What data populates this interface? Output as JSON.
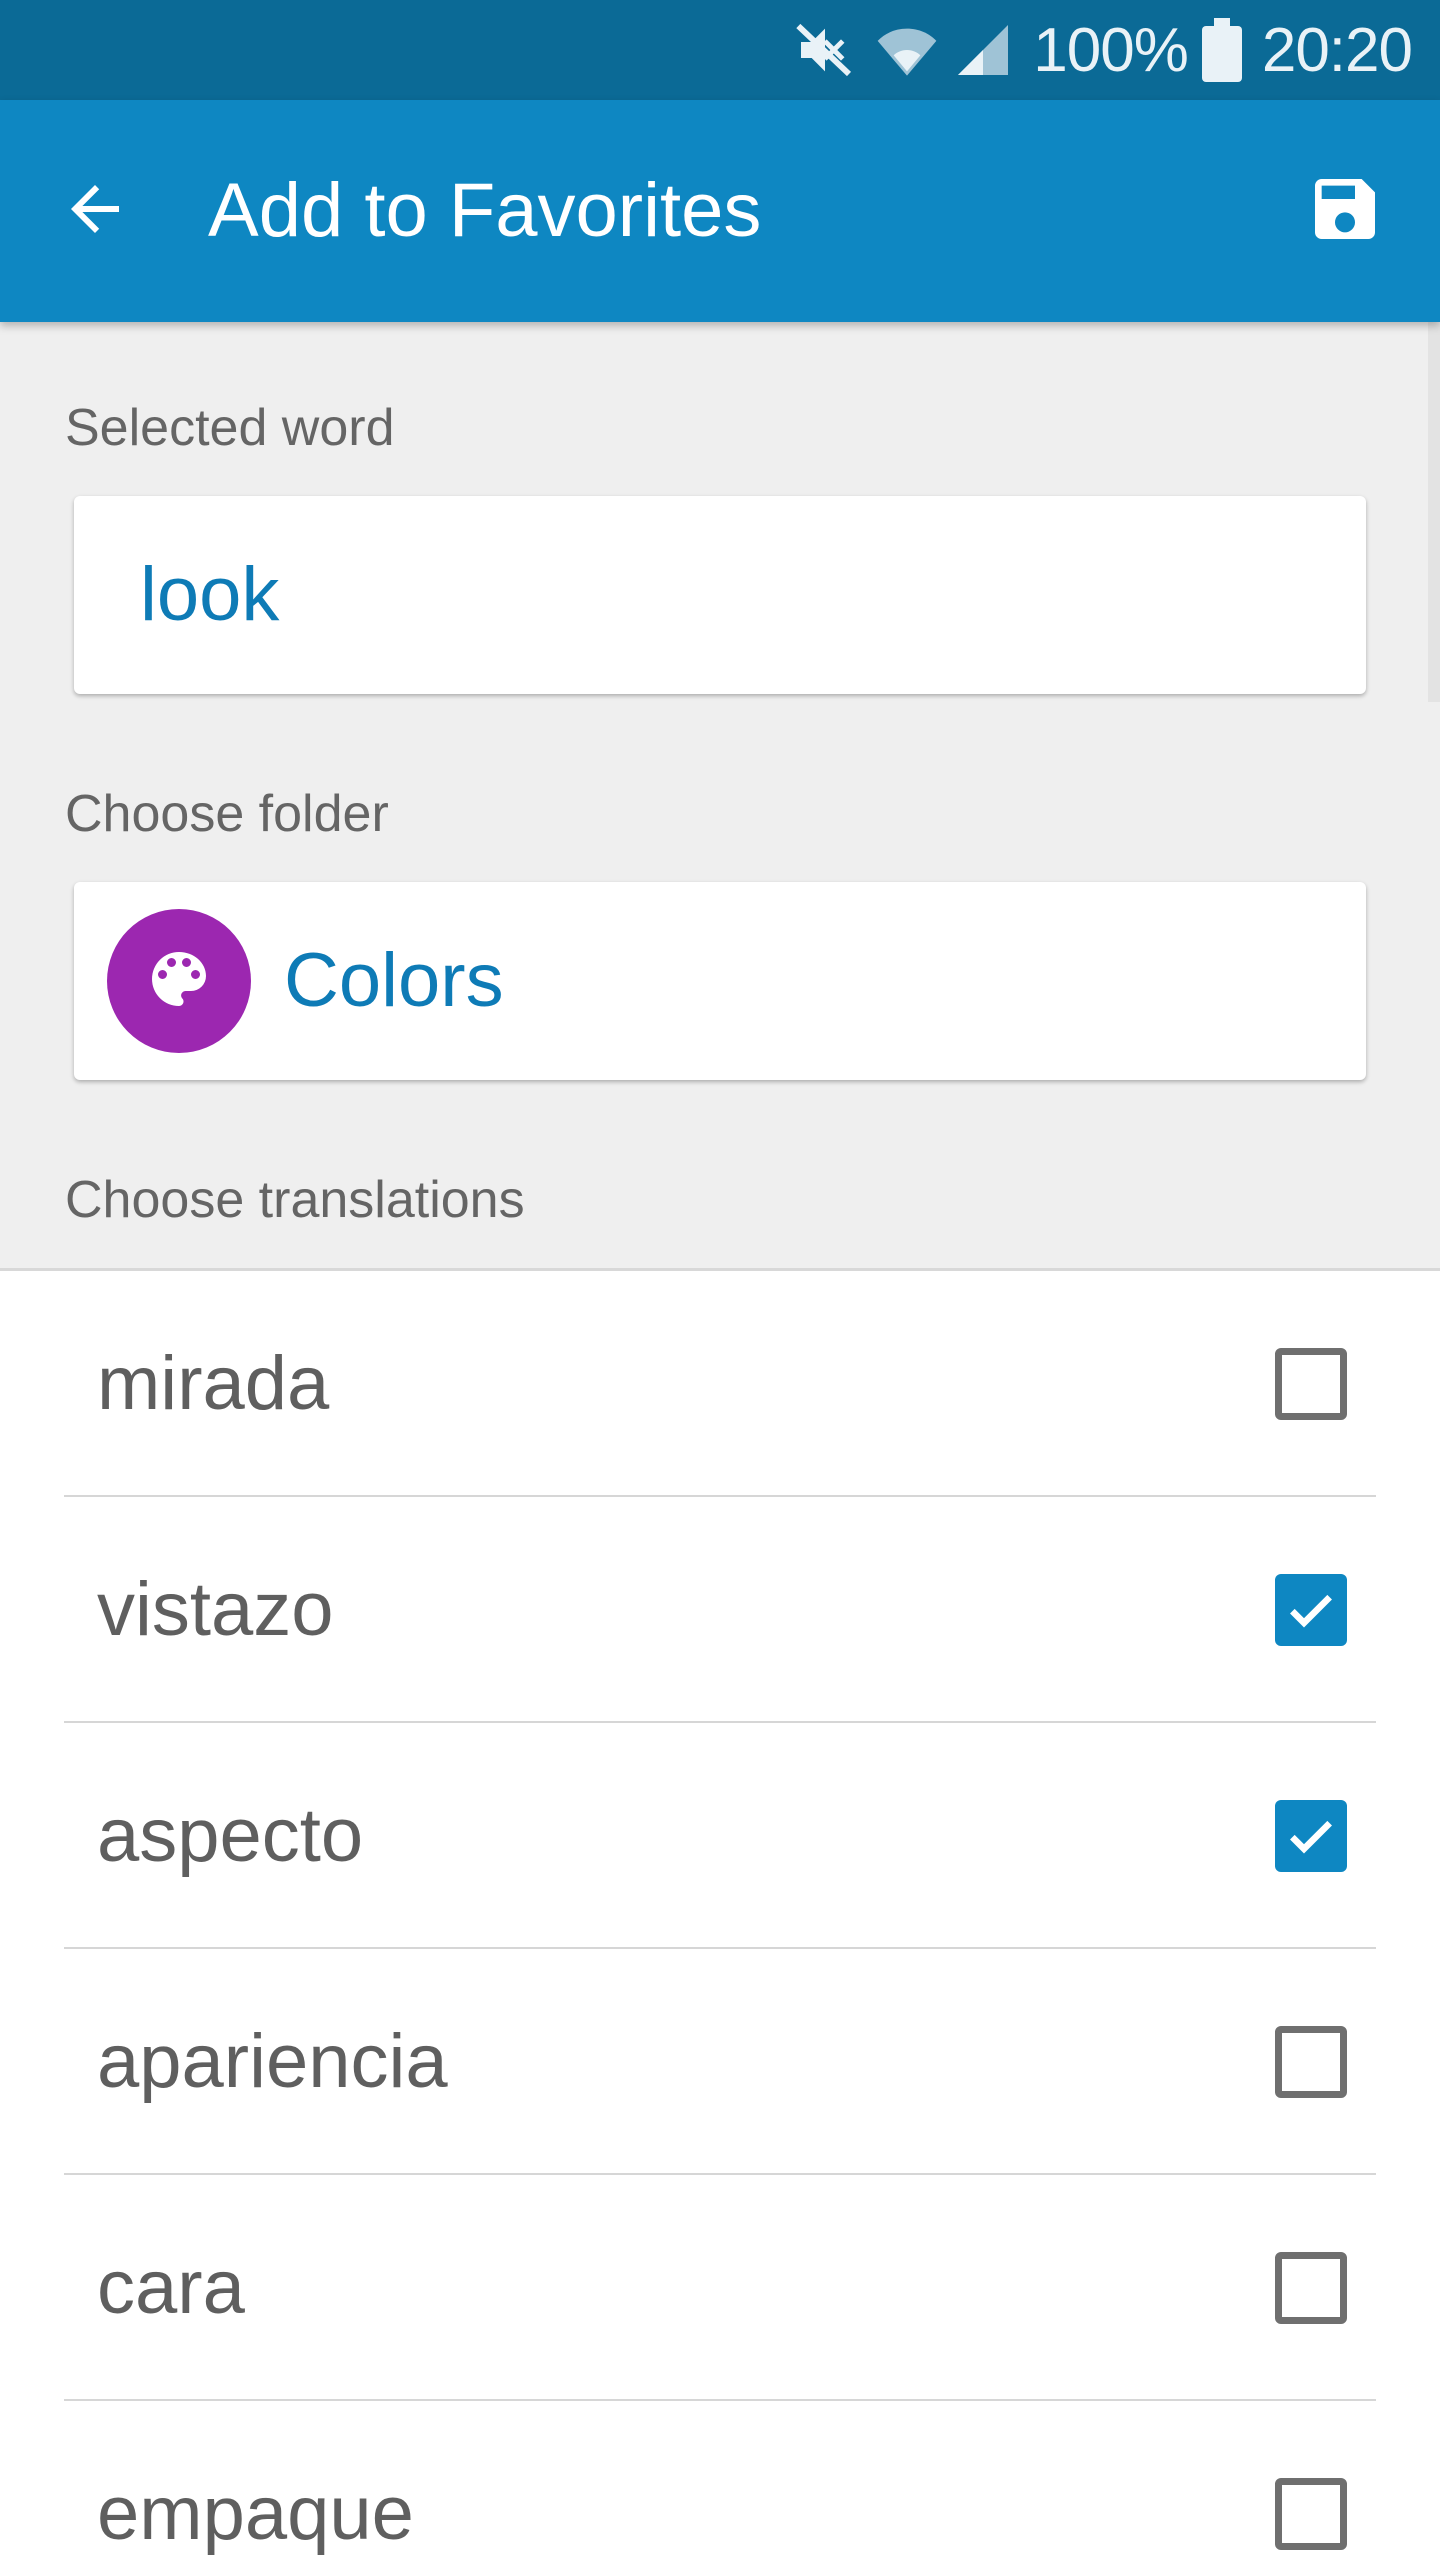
{
  "status_bar": {
    "battery": "100%",
    "time": "20:20",
    "icons": [
      "mute-icon",
      "wifi-icon",
      "signal-icon",
      "battery-icon"
    ]
  },
  "app_bar": {
    "title": "Add to Favorites",
    "back_icon": "arrow-left-icon",
    "save_icon": "save-icon",
    "color": "#0e87c2"
  },
  "selected_word": {
    "label": "Selected word",
    "value": "look"
  },
  "folder": {
    "label": "Choose folder",
    "name": "Colors",
    "icon": "palette-icon",
    "color": "#9c27b0"
  },
  "translations": {
    "label": "Choose translations",
    "items": [
      {
        "text": "mirada",
        "checked": false
      },
      {
        "text": "vistazo",
        "checked": true
      },
      {
        "text": "aspecto",
        "checked": true
      },
      {
        "text": "apariencia",
        "checked": false
      },
      {
        "text": "cara",
        "checked": false
      },
      {
        "text": "empaque",
        "checked": false
      }
    ]
  }
}
